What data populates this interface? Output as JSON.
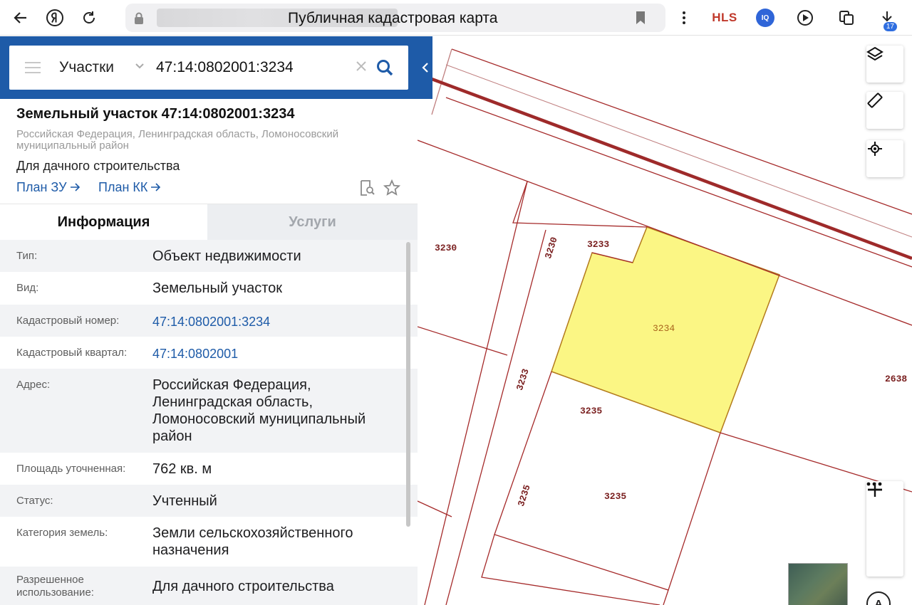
{
  "browser": {
    "tab_title": "Публичная кадастровая карта",
    "toolbar_text": "HLS",
    "iq_badge": "IQ",
    "downloads_count": "17"
  },
  "search": {
    "type_label": "Участки",
    "query": "47:14:0802001:3234"
  },
  "card": {
    "title": "Земельный участок 47:14:0802001:3234",
    "address": "Российская Федерация, Ленинградская область, Ломоносовский муниципальный район",
    "use": "Для дачного строительства",
    "plan_zu": "План ЗУ",
    "plan_kk": "План КК"
  },
  "tabs": {
    "info": "Информация",
    "services": "Услуги"
  },
  "properties": [
    {
      "key": "Тип:",
      "value": "Объект недвижимости",
      "link": false
    },
    {
      "key": "Вид:",
      "value": "Земельный участок",
      "link": false
    },
    {
      "key": "Кадастровый номер:",
      "value": "47:14:0802001:3234",
      "link": true
    },
    {
      "key": "Кадастровый квартал:",
      "value": "47:14:0802001",
      "link": true
    },
    {
      "key": "Адрес:",
      "value": "Российская Федерация, Ленинградская область, Ломоносовский муниципальный район",
      "link": false
    },
    {
      "key": "Площадь уточненная:",
      "value": "762 кв. м",
      "link": false
    },
    {
      "key": "Статус:",
      "value": "Учтенный",
      "link": false
    },
    {
      "key": "Категория земель:",
      "value": "Земли сельскохозяйственного назначения",
      "link": false
    },
    {
      "key": "Разрешенное использование:",
      "value": "Для дачного строительства",
      "link": false
    }
  ],
  "map": {
    "parcel_labels": [
      "3230",
      "3230",
      "3233",
      "3234",
      "3233",
      "2638",
      "3235",
      "3235",
      "3235"
    ],
    "highlight_color": "#fbf684",
    "boundary_color": "#a52a2a",
    "controls": [
      "layers-icon",
      "ruler-icon",
      "locate-icon",
      "zoom-in",
      "more",
      "zoom-out"
    ],
    "compass_label": "A"
  }
}
